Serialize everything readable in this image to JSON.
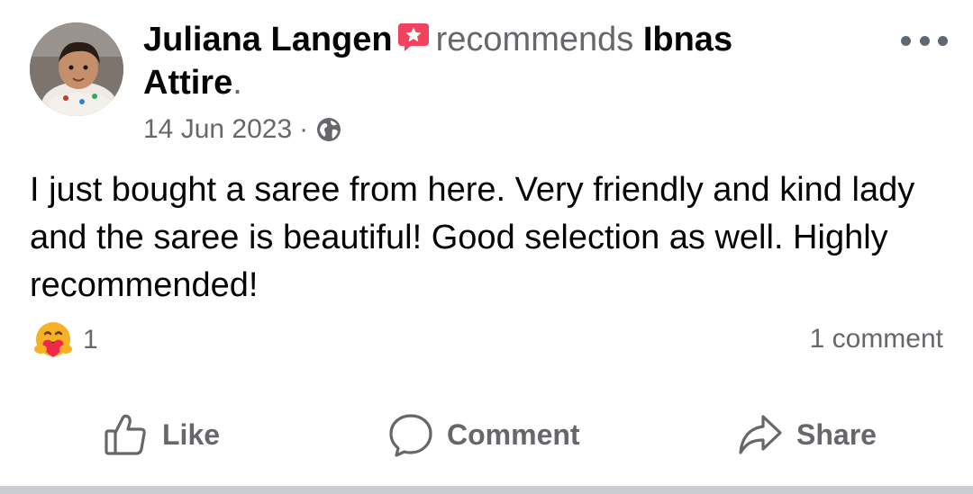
{
  "post": {
    "author": "Juliana Langen",
    "verb": "recommends",
    "page_name": "Ibnas Attire",
    "end_punct": ".",
    "date": "14 Jun 2023",
    "separator": "·",
    "privacy_icon": "globe-icon",
    "text": "I just bought a saree from here. Very friendly and kind lady and the saree is beautiful! Good selection as well. Highly recommended!",
    "reaction_icon": "care-reaction-icon",
    "reaction_count": "1",
    "comment_count": "1 comment"
  },
  "actions": {
    "like": "Like",
    "comment": "Comment",
    "share": "Share"
  },
  "colors": {
    "text": "#050505",
    "secondary": "#65676b",
    "badge": "#f3425f",
    "divider": "#c9ccd1"
  }
}
